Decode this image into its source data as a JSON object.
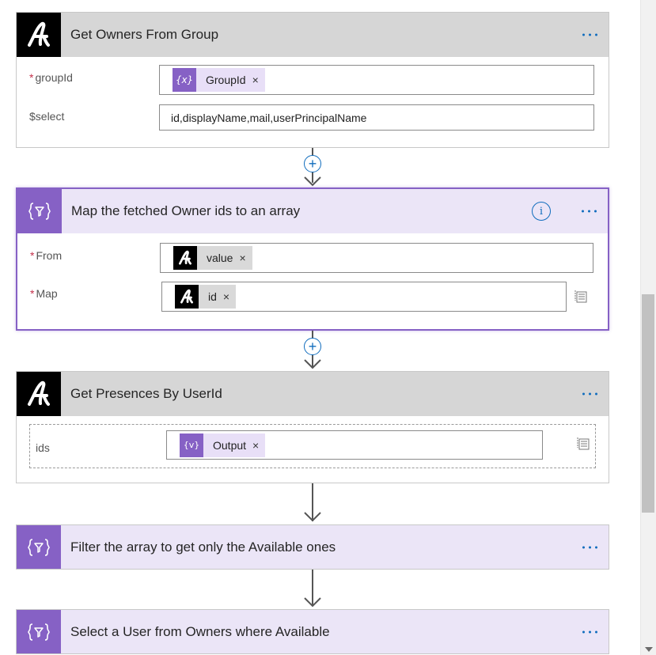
{
  "colors": {
    "accent": "#0f6cbd",
    "variable_purple": "#8661c5",
    "header_gray": "#d6d6d6",
    "header_purple": "#ebe5f7",
    "required": "#c4314b"
  },
  "cards": {
    "owners": {
      "title": "Get Owners From Group",
      "icon": "adobe-sign-logo-icon",
      "params": {
        "group_id": {
          "label": "groupId",
          "required": true,
          "token": {
            "label": "GroupId",
            "icon": "variable-icon",
            "symbol": "{x}"
          }
        },
        "select": {
          "label": "$select",
          "value": "id,displayName,mail,userPrincipalName"
        }
      }
    },
    "map": {
      "title": "Map the fetched Owner ids to an array",
      "icon": "data-operation-icon",
      "info_symbol": "i",
      "params": {
        "from": {
          "label": "From",
          "required": true,
          "token": {
            "label": "value",
            "icon": "adobe-sign-logo-icon"
          }
        },
        "map": {
          "label": "Map",
          "required": true,
          "token": {
            "label": "id",
            "icon": "adobe-sign-logo-icon"
          }
        }
      }
    },
    "presences": {
      "title": "Get Presences By UserId",
      "icon": "adobe-sign-logo-icon",
      "params": {
        "ids": {
          "label": "ids",
          "token": {
            "label": "Output",
            "icon": "variable-icon",
            "symbol": "{v}"
          }
        }
      }
    },
    "filter": {
      "title": "Filter the array to get only the Available ones",
      "icon": "data-operation-icon"
    },
    "select_user": {
      "title": "Select a User from Owners where Available",
      "icon": "data-operation-icon"
    }
  },
  "glyphs": {
    "remove": "×",
    "required_mark": "*",
    "add_step": "+"
  }
}
